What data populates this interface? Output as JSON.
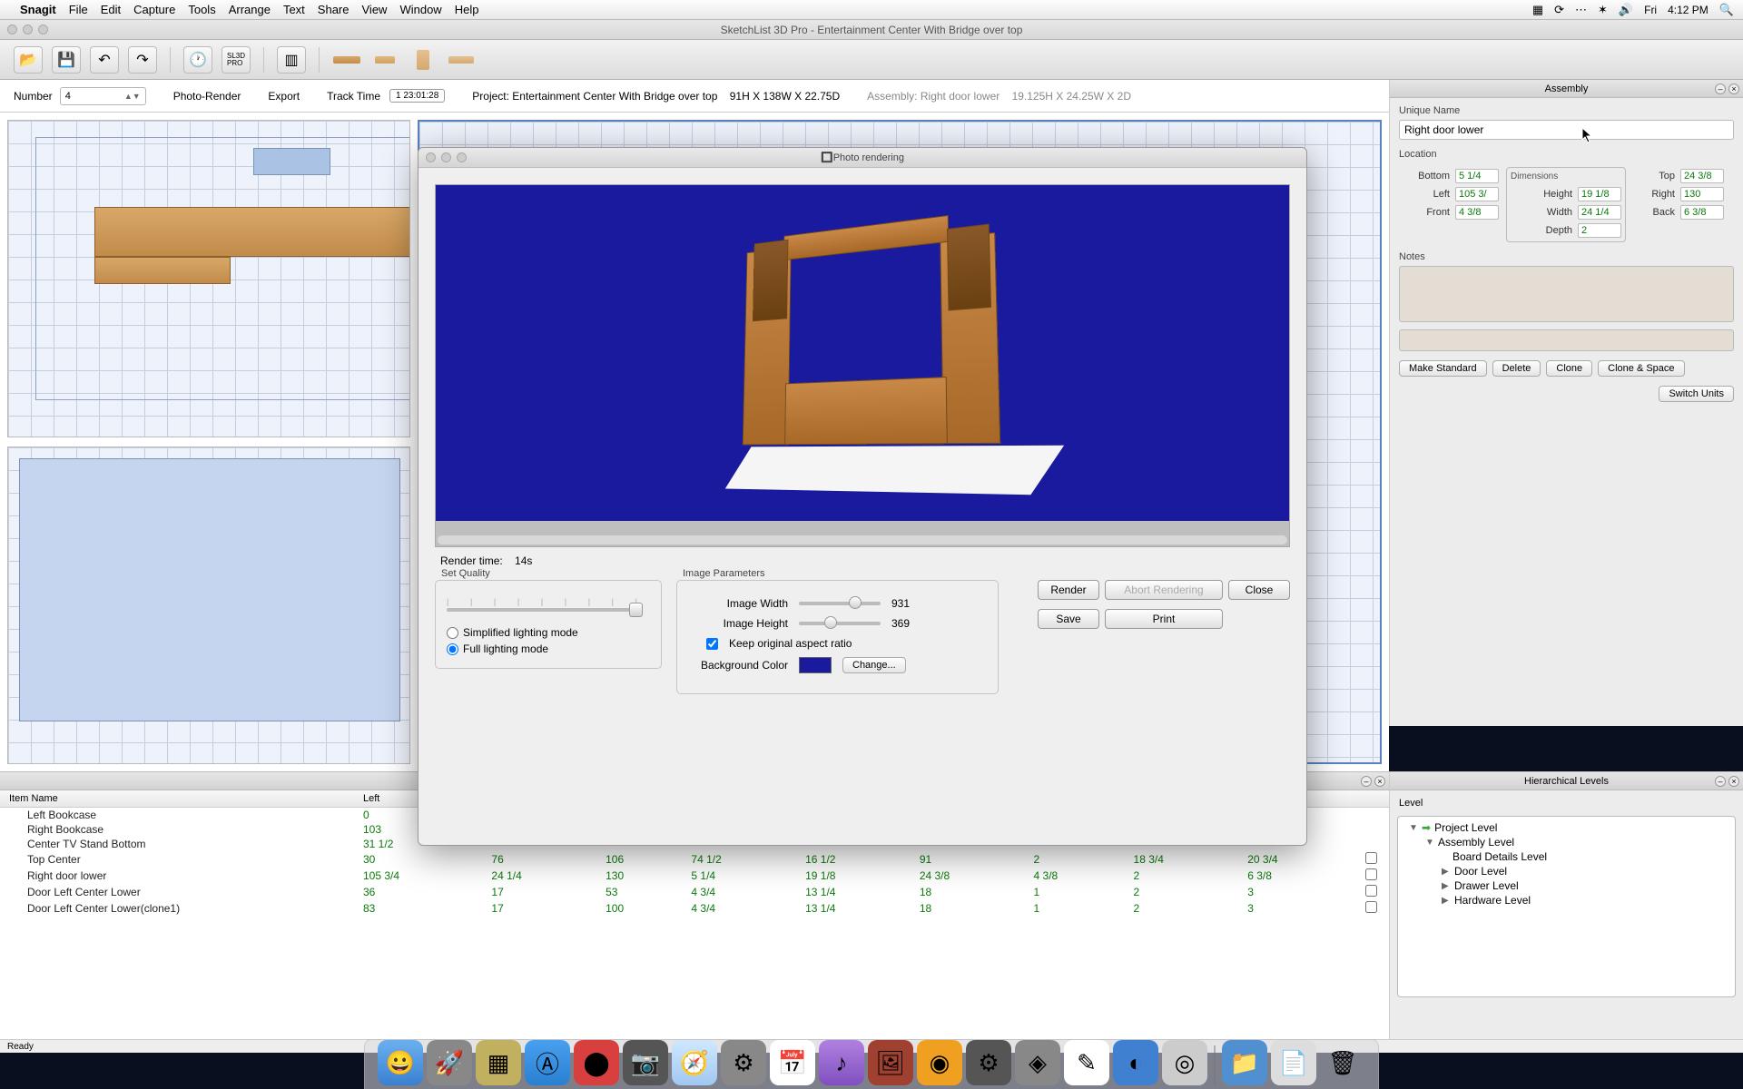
{
  "menubar": {
    "appname": "Snagit",
    "items": [
      "File",
      "Edit",
      "Capture",
      "Tools",
      "Arrange",
      "Text",
      "Share",
      "View",
      "Window",
      "Help"
    ],
    "right": {
      "day": "Fri",
      "time": "4:12 PM"
    }
  },
  "window": {
    "title": "SketchList 3D Pro - Entertainment Center With Bridge over top"
  },
  "toolbar": {
    "sl3d_label": "SL3D\nPRO"
  },
  "infobar": {
    "number_label": "Number",
    "number_value": "4",
    "photo_render": "Photo-Render",
    "export": "Export",
    "track_time": "Track Time",
    "track_time_value": "1 23:01:28",
    "project_label": "Project:",
    "project_name": "Entertainment Center With Bridge over top",
    "project_dims": "91H X 138W X 22.75D",
    "assembly_label": "Assembly:",
    "assembly_name": "Right door lower",
    "assembly_dims": "19.125H X 24.25W X 2D"
  },
  "assembly_panel": {
    "title": "Assembly",
    "unique_name_label": "Unique Name",
    "unique_name_value": "Right door lower",
    "location_label": "Location",
    "dimensions_label": "Dimensions",
    "fields": {
      "bottom_lbl": "Bottom",
      "bottom_val": "5 1/4",
      "left_lbl": "Left",
      "left_val": "105 3/",
      "front_lbl": "Front",
      "front_val": "4 3/8",
      "height_lbl": "Height",
      "height_val": "19 1/8",
      "width_lbl": "Width",
      "width_val": "24 1/4",
      "depth_lbl": "Depth",
      "depth_val": "2",
      "top_lbl": "Top",
      "top_val": "24 3/8",
      "right_lbl": "Right",
      "right_val": "130",
      "back_lbl": "Back",
      "back_val": "6 3/8"
    },
    "notes_label": "Notes",
    "buttons": {
      "make_standard": "Make Standard",
      "delete": "Delete",
      "clone": "Clone",
      "clone_space": "Clone & Space",
      "switch_units": "Switch Units"
    }
  },
  "itemlist": {
    "headers": {
      "name": "Item Name",
      "left": "Left"
    },
    "rows": [
      {
        "name": "Left Bookcase",
        "vals": [
          "0"
        ]
      },
      {
        "name": "Right Bookcase",
        "vals": [
          "103"
        ]
      },
      {
        "name": "Center TV Stand Bottom",
        "vals": [
          "31 1/2"
        ]
      },
      {
        "name": "Top Center",
        "vals": [
          "30",
          "76",
          "106",
          "74 1/2",
          "16 1/2",
          "91",
          "2",
          "18 3/4",
          "20 3/4"
        ],
        "cb": true
      },
      {
        "name": "Right door lower",
        "vals": [
          "105 3/4",
          "24 1/4",
          "130",
          "5 1/4",
          "19 1/8",
          "24 3/8",
          "4 3/8",
          "2",
          "6 3/8"
        ],
        "cb": true
      },
      {
        "name": "Door Left Center Lower",
        "vals": [
          "36",
          "17",
          "53",
          "4 3/4",
          "13 1/4",
          "18",
          "1",
          "2",
          "3"
        ],
        "cb": true
      },
      {
        "name": "Door Left Center Lower(clone1)",
        "vals": [
          "83",
          "17",
          "100",
          "4 3/4",
          "13 1/4",
          "18",
          "1",
          "2",
          "3"
        ],
        "cb": true
      }
    ]
  },
  "hier": {
    "title": "Hierarchical Levels",
    "level_label": "Level",
    "items": [
      "Project Level",
      "Assembly Level",
      "Board Details Level",
      "Door Level",
      "Drawer Level",
      "Hardware Level"
    ]
  },
  "modal": {
    "title": "Photo rendering",
    "render_time_label": "Render time:",
    "render_time_value": "14s",
    "quality_label": "Set Quality",
    "lighting_simple": "Simplified lighting mode",
    "lighting_full": "Full lighting mode",
    "params_label": "Image Parameters",
    "image_width_label": "Image Width",
    "image_width_value": "931",
    "image_height_label": "Image Height",
    "image_height_value": "369",
    "keep_aspect_label": "Keep original aspect ratio",
    "bgcolor_label": "Background Color",
    "change_btn": "Change...",
    "render_btn": "Render",
    "abort_btn": "Abort Rendering",
    "close_btn": "Close",
    "save_btn": "Save",
    "print_btn": "Print"
  },
  "status": {
    "ready": "Ready"
  }
}
